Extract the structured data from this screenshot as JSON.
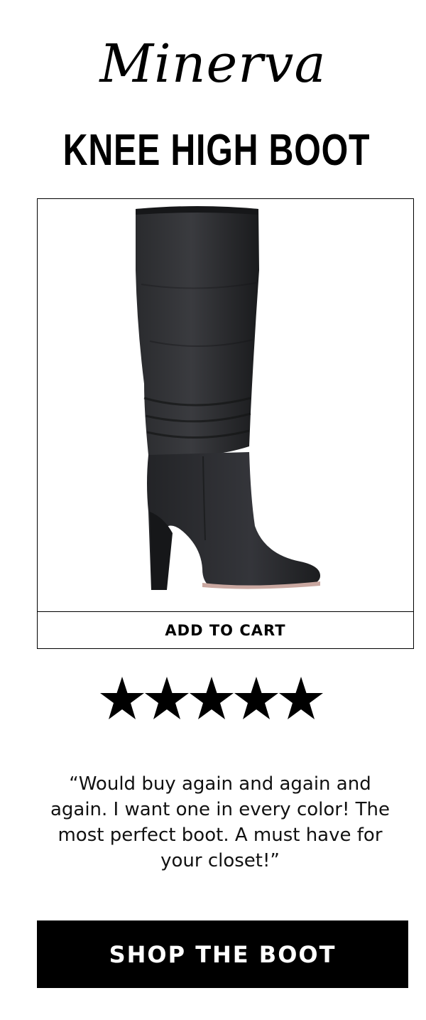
{
  "header": {
    "script_title": "Minerva",
    "headline": "KNEE HIGH BOOT"
  },
  "product": {
    "image_alt": "black-leather-knee-high-boot",
    "add_to_cart_label": "ADD TO CART"
  },
  "review": {
    "rating": 5,
    "rating_max": 5,
    "quote": "“Would buy again and again and again. I want one in every color! The most perfect boot. A must have for your closet!”"
  },
  "cta": {
    "shop_label": "SHOP THE BOOT"
  },
  "colors": {
    "text": "#000000",
    "background": "#ffffff",
    "button_bg": "#000000",
    "button_text": "#ffffff",
    "boot": "#1e1f21"
  }
}
